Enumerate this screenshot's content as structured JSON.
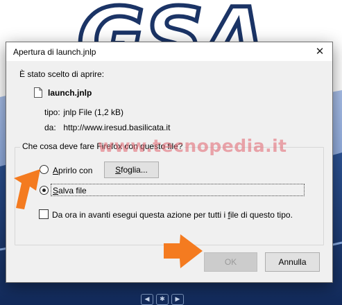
{
  "dialog": {
    "title": "Apertura di launch.jnlp",
    "close_label": "✕",
    "chosen_label": "È stato scelto di aprire:",
    "file_name": "launch.jnlp",
    "type_key": "tipo:",
    "type_value": "jnlp File (1,2 kB)",
    "from_key": "da:",
    "from_value": "http://www.iresud.basilicata.it",
    "question": "Che cosa deve fare Firefox con questo file?",
    "open_with": {
      "prefix": "",
      "access_key": "A",
      "rest": "prirlo con"
    },
    "browse": {
      "prefix": "",
      "access_key": "S",
      "rest": "foglia..."
    },
    "save": {
      "prefix": "",
      "access_key": "S",
      "rest": "alva file"
    },
    "remember": {
      "prefix": "Da ora in avanti esegui questa azione per tutti i ",
      "access_key": "f",
      "rest": "ile di questo tipo."
    },
    "ok_label": "OK",
    "cancel_label": "Annulla"
  },
  "watermark": "www.tecnopedia.it",
  "background": {
    "logo_text": "GSA"
  },
  "colors": {
    "arrow": "#f47b20",
    "watermark": "#e26e78",
    "band_light": "#7fa0d8",
    "band_dark": "#1d3f7e"
  }
}
